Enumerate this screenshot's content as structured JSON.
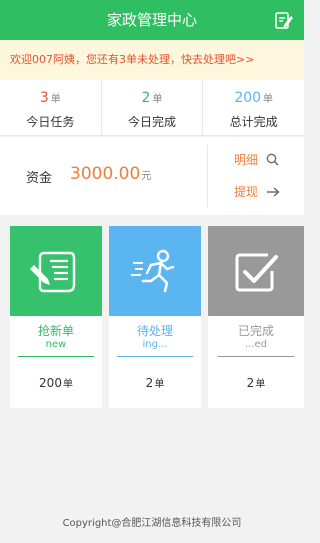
{
  "header": {
    "title": "家政管理中心",
    "edit_icon": "edit-icon"
  },
  "notice": {
    "text": "欢迎007阿姨，您还有3单未处理，快去处理吧>>",
    "color": "#e4532e"
  },
  "stats": [
    {
      "value": "3",
      "unit": "单",
      "label": "今日任务",
      "color": "#e4532e"
    },
    {
      "value": "2",
      "unit": "单",
      "label": "今日完成",
      "color": "#2fbf62"
    },
    {
      "value": "200",
      "unit": "单",
      "label": "总计完成",
      "color": "#5bb5f1"
    }
  ],
  "funds": {
    "label": "资金",
    "amount": "3000.00",
    "currency": "元",
    "detail_label": "明细",
    "withdraw_label": "提现"
  },
  "cards": [
    {
      "name": "抢新单",
      "sub": "new",
      "count": "200",
      "unit": "单",
      "icon": "document-pen-icon",
      "color": "#36c26c"
    },
    {
      "name": "待处理",
      "sub": "ing...",
      "count": "2",
      "unit": "单",
      "icon": "running-person-icon",
      "color": "#5bb5f1"
    },
    {
      "name": "已完成",
      "sub": "...ed",
      "count": "2",
      "unit": "单",
      "icon": "checkbox-done-icon",
      "color": "#999999"
    }
  ],
  "footer": {
    "text": "Copyright@合肥江湖信息科技有限公司"
  }
}
